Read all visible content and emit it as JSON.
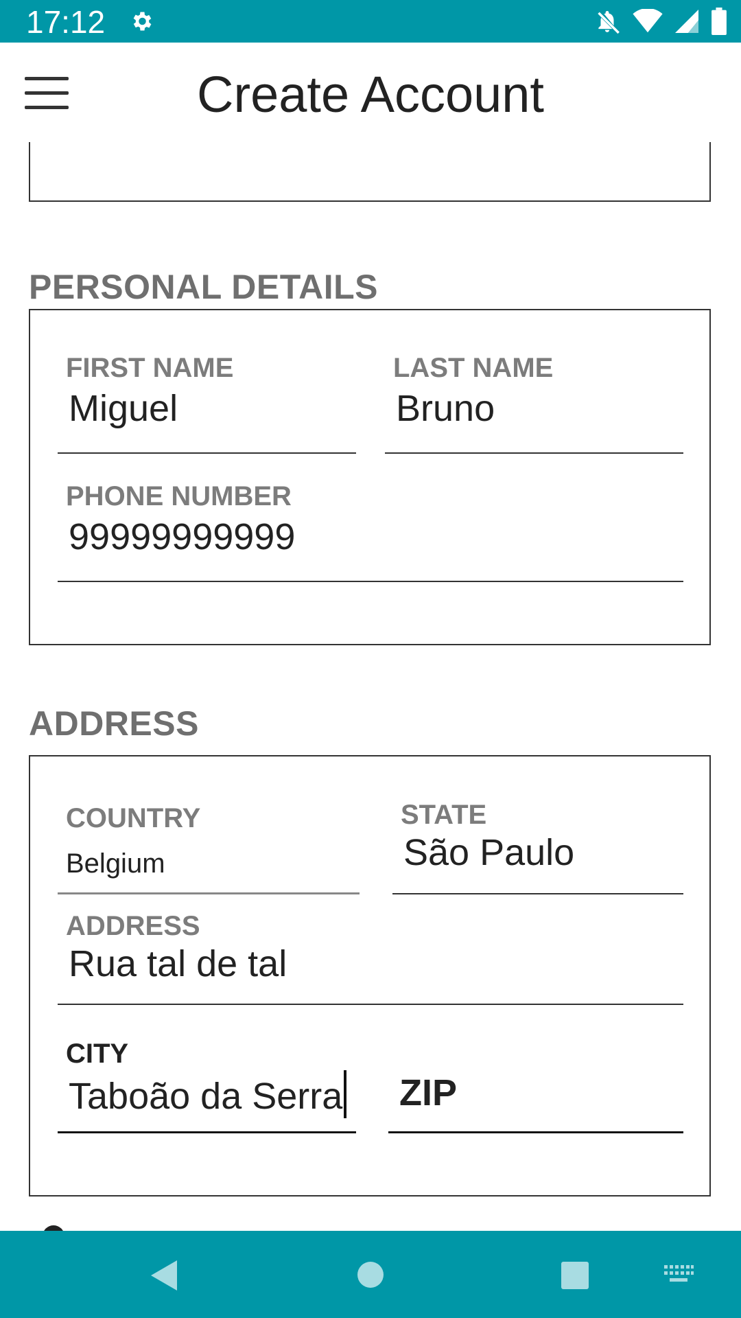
{
  "status_bar": {
    "time": "17:12"
  },
  "app_bar": {
    "title": "Create Account"
  },
  "personal": {
    "title": "PERSONAL DETAILS",
    "first_name": {
      "label": "FIRST NAME",
      "value": "Miguel"
    },
    "last_name": {
      "label": "LAST NAME",
      "value": "Bruno"
    },
    "phone": {
      "label": "PHONE NUMBER",
      "value": "99999999999"
    }
  },
  "address": {
    "title": "ADDRESS",
    "country": {
      "label": "COUNTRY",
      "value": "Belgium"
    },
    "state": {
      "label": "STATE",
      "value": "São Paulo"
    },
    "address": {
      "label": "ADDRESS",
      "value": "Rua tal de tal"
    },
    "city": {
      "label": "CITY",
      "value": "Taboão da Serra"
    },
    "zip": {
      "placeholder": "ZIP"
    }
  },
  "colors": {
    "accent": "#0097a7",
    "label": "#7c7c7c",
    "text": "#222222"
  }
}
